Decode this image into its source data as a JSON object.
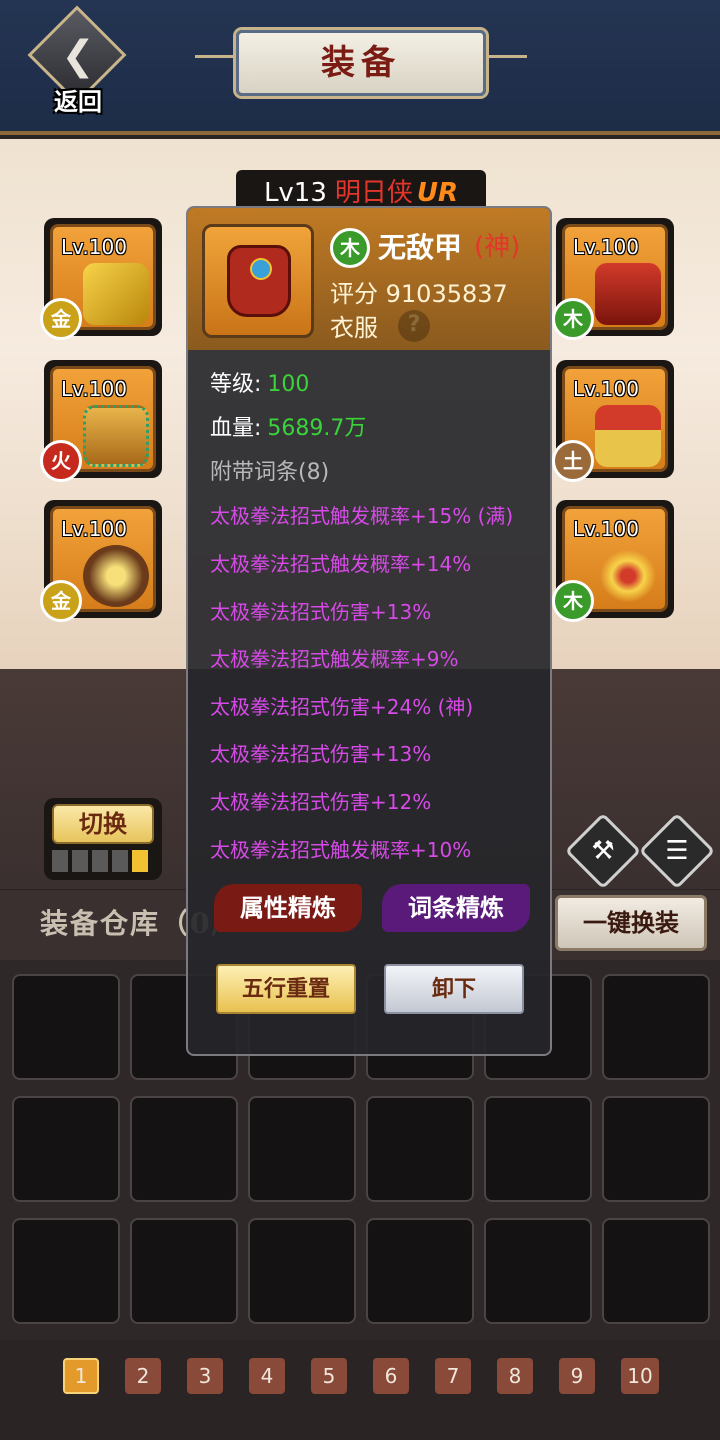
{
  "header": {
    "back_label": "返回",
    "title": "装备"
  },
  "hero": {
    "level": "Lv13",
    "name": "明日侠",
    "rank": "UR"
  },
  "slots": [
    {
      "level": "Lv.100",
      "element": "金",
      "element_color": "#c9a21a",
      "icon": "golden-sword-icon"
    },
    {
      "level": "Lv.100",
      "element": "火",
      "element_color": "#c62a1e",
      "icon": "jeweled-bracer-icon"
    },
    {
      "level": "Lv.100",
      "element": "金",
      "element_color": "#c9a21a",
      "icon": "medallion-icon"
    },
    {
      "level": "Lv.100",
      "element": "木",
      "element_color": "#3a9a2a",
      "icon": "red-armor-icon"
    },
    {
      "level": "Lv.100",
      "element": "土",
      "element_color": "#9a6a3a",
      "icon": "boots-icon"
    },
    {
      "level": "Lv.100",
      "element": "木",
      "element_color": "#3a9a2a",
      "icon": "gold-ring-icon"
    }
  ],
  "switch": {
    "label": "切换",
    "pips_total": 5,
    "pips_active": 5
  },
  "side_actions": {
    "enhance_label": "强化",
    "affix_label": "词条"
  },
  "warehouse": {
    "label": "装备仓库（0/",
    "one_key_label": "一键换装"
  },
  "popup": {
    "item_element": "木",
    "item_name": "无敌甲",
    "item_rank": "(神)",
    "score_label": "评分",
    "score_value": "91035837",
    "item_type": "衣服",
    "help": "?",
    "level_key": "等级:",
    "level_value": "100",
    "hp_key": "血量:",
    "hp_value": "5689.7万",
    "affix_title": "附带词条(8)",
    "affixes": [
      "太极拳法招式触发概率+15% (满)",
      "太极拳法招式触发概率+14%",
      "太极拳法招式伤害+13%",
      "太极拳法招式触发概率+9%",
      "太极拳法招式伤害+24% (神)",
      "太极拳法招式伤害+13%",
      "太极拳法招式伤害+12%",
      "太极拳法招式触发概率+10%"
    ],
    "refine_attr_label": "属性精炼",
    "refine_affix_label": "词条精炼",
    "reset_label": "五行重置",
    "unequip_label": "卸下"
  },
  "pager": {
    "pages": [
      "1",
      "2",
      "3",
      "4",
      "5",
      "6",
      "7",
      "8",
      "9",
      "10"
    ],
    "active": "1"
  },
  "colors": {
    "affix": "#d74ae8",
    "stat_value": "#3ad43a",
    "header_bg": "#243553"
  }
}
